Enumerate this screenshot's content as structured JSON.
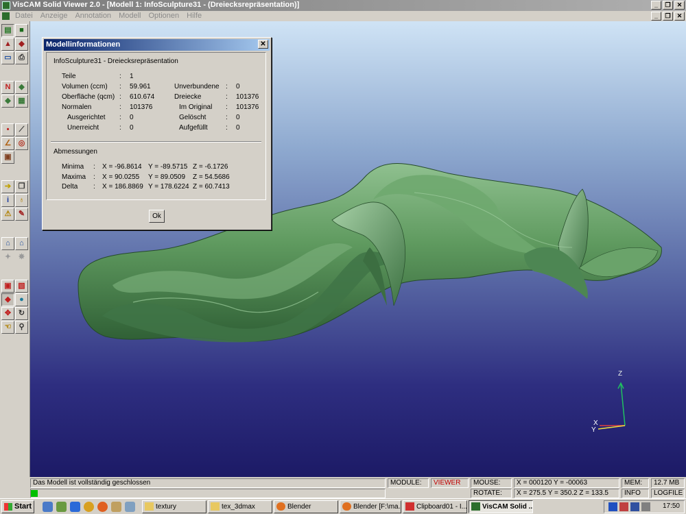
{
  "window": {
    "title": "VisCAM Solid Viewer 2.0 - [Modell 1: InfoSculpture31 - (Dreiecksrepräsentation)]"
  },
  "menu": [
    "Datei",
    "Anzeige",
    "Annotation",
    "Modell",
    "Optionen",
    "Hilfe"
  ],
  "dialog": {
    "title": "Modellinformationen",
    "heading": "InfoSculpture31 - Dreiecksrepräsentation",
    "rows_left": [
      {
        "label": "Teile",
        "value": "1"
      },
      {
        "label": "Volumen (ccm)",
        "value": "59.961"
      },
      {
        "label": "Oberfläche (qcm)",
        "value": "610.674"
      },
      {
        "label": "Normalen",
        "value": "101376"
      },
      {
        "label": "Ausgerichtet",
        "value": "0"
      },
      {
        "label": "Unerreicht",
        "value": "0"
      }
    ],
    "rows_right": [
      {
        "label": "Unverbundene",
        "value": "0"
      },
      {
        "label": "Dreiecke",
        "value": "101376"
      },
      {
        "label": "Im Original",
        "value": "101376"
      },
      {
        "label": "Gelöscht",
        "value": "0"
      },
      {
        "label": "Aufgefüllt",
        "value": "0"
      }
    ],
    "dims_heading": "Abmessungen",
    "dims": [
      {
        "label": "Minima",
        "x": "X = -96.8614",
        "y": "Y = -89.5715",
        "z": "Z = -6.1726"
      },
      {
        "label": "Maxima",
        "x": "X = 90.0255",
        "y": "Y = 89.0509",
        "z": "Z = 54.5686"
      },
      {
        "label": "Delta",
        "x": "X = 186.8869",
        "y": "Y = 178.6224",
        "z": "Z = 60.7413"
      }
    ],
    "ok_label": "Ok"
  },
  "axes": {
    "z": "Z",
    "x": "X",
    "y": "Y"
  },
  "status": {
    "message": "Das Modell ist vollständig geschlossen",
    "module_label": "MODULE:",
    "module_value": "VIEWER",
    "mouse_label": "MOUSE:",
    "mouse_value": "X = 000120   Y = -00063",
    "rotate_label": "ROTATE:",
    "rotate_value": "X = 275.5   Y = 350.2   Z = 133.5",
    "mem_label": "MEM:",
    "mem_value": "12.7 MB",
    "info_label": "INFO",
    "logfile_label": "LOGFILE",
    "progress": 0.02
  },
  "taskbar": {
    "start": "Start",
    "tasks": [
      "textury",
      "tex_3dmax",
      "Blender",
      "Blender [F:\\ma...",
      "Clipboard01 - I...",
      "VisCAM Solid ..."
    ],
    "clock": "17:50"
  },
  "colors": {
    "sculpture": "#5f9a5f",
    "title_active": "#0a246a",
    "status_red": "#c00000"
  }
}
